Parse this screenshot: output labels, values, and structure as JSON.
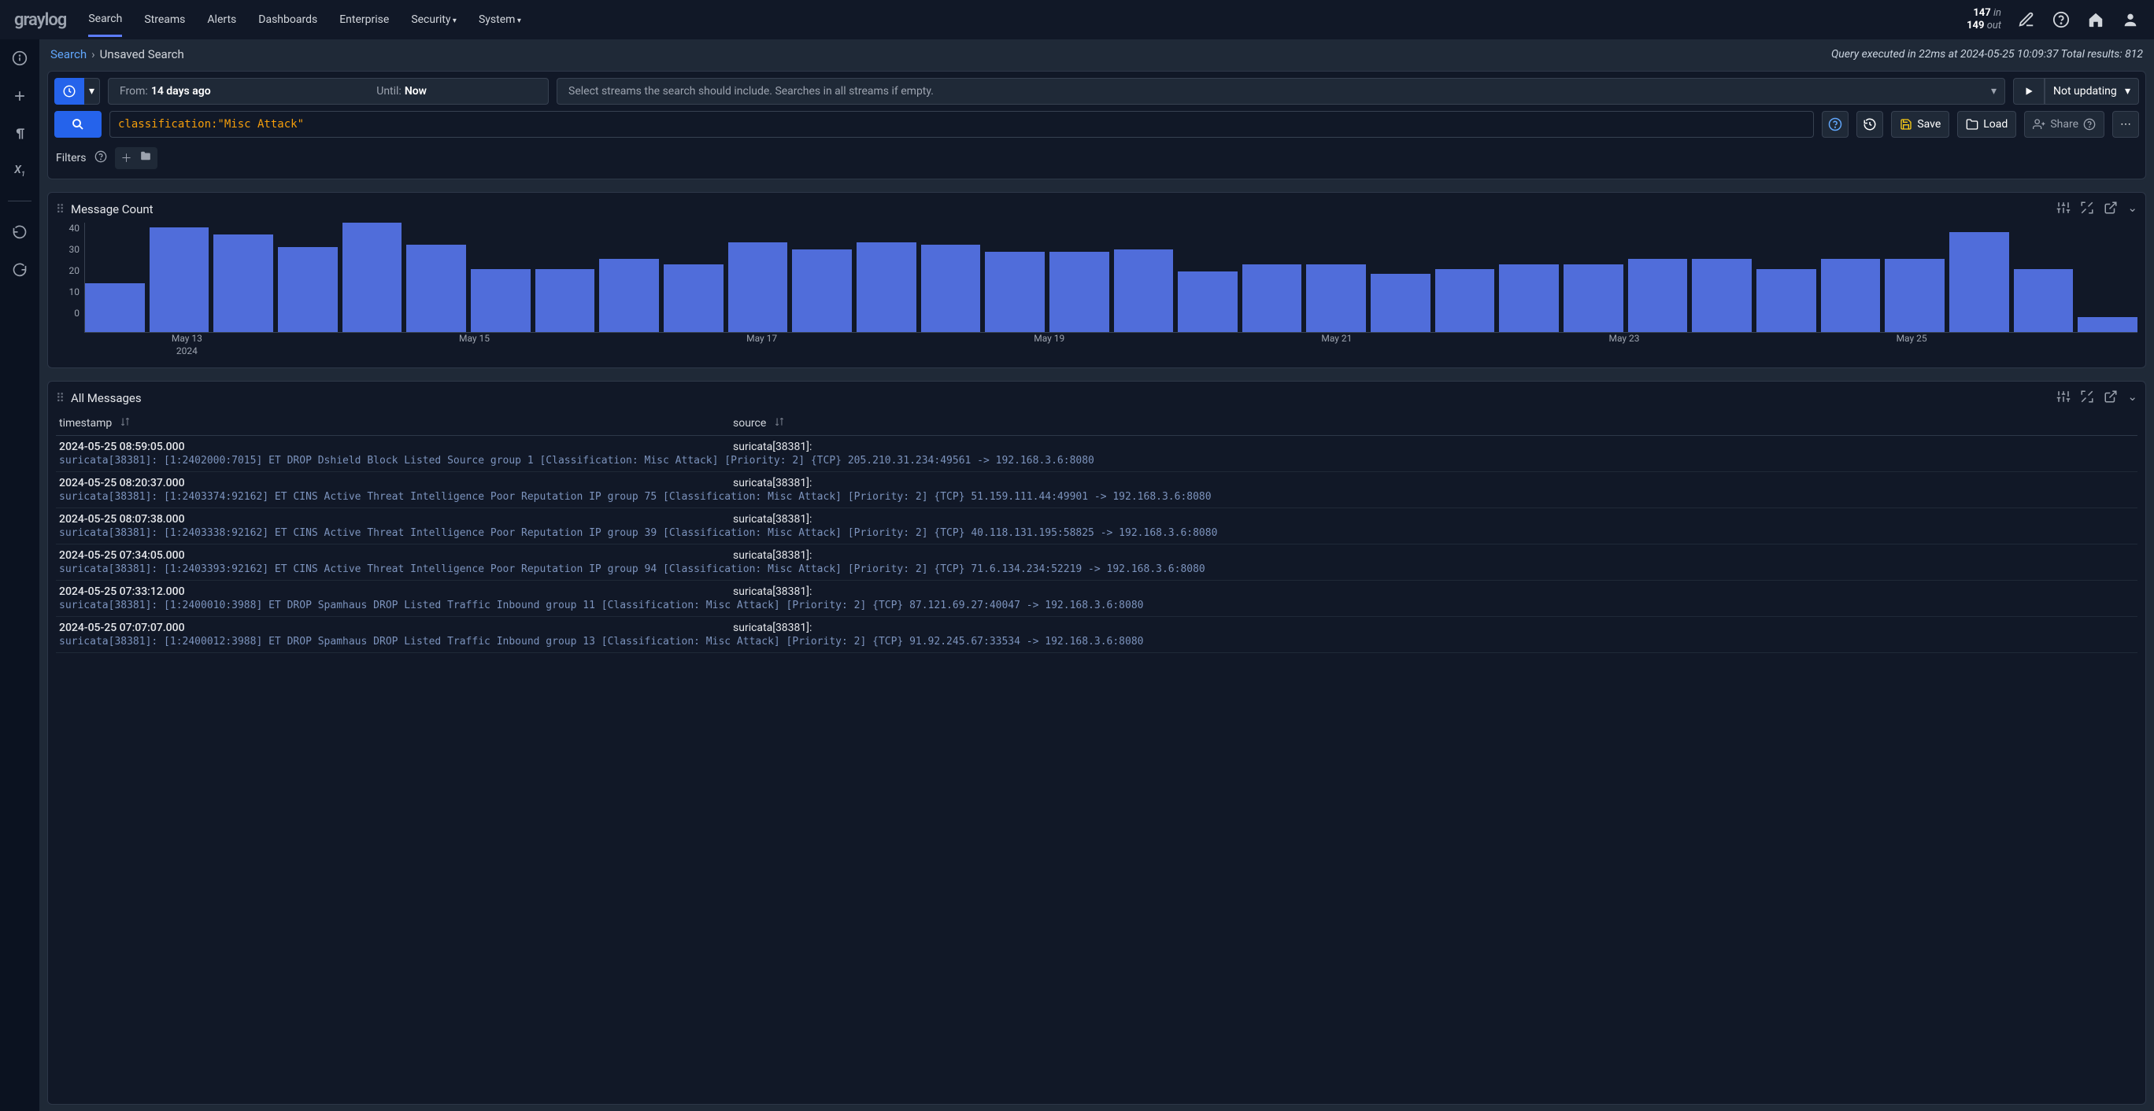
{
  "brand": "graylog",
  "nav": {
    "items": [
      "Search",
      "Streams",
      "Alerts",
      "Dashboards",
      "Enterprise",
      "Security",
      "System"
    ],
    "active": "Search",
    "dropdowns": [
      "Security",
      "System"
    ]
  },
  "io": {
    "in_n": "147",
    "in_l": "in",
    "out_n": "149",
    "out_l": "out"
  },
  "breadcrumb": {
    "root": "Search",
    "sep": "›",
    "current": "Unsaved Search"
  },
  "exec": "Query executed in 22ms at 2024-05-25 10:09:37 Total results: 812",
  "time": {
    "from_l": "From:",
    "from_v": "14 days ago",
    "until_l": "Until:",
    "until_v": "Now"
  },
  "streams_ph": "Select streams the search should include. Searches in all streams if empty.",
  "update": {
    "label": "Not updating"
  },
  "query": "classification:\"Misc Attack\"",
  "actions": {
    "save": "Save",
    "load": "Load",
    "share": "Share"
  },
  "filters_label": "Filters",
  "widget_mc": {
    "title": "Message Count"
  },
  "widget_am": {
    "title": "All Messages",
    "col_ts": "timestamp",
    "col_src": "source"
  },
  "chart_data": {
    "type": "bar",
    "ylabel": "",
    "ylim": [
      0,
      45
    ],
    "yticks": [
      0,
      10,
      20,
      30,
      40
    ],
    "xticks": [
      {
        "pos": 5,
        "label": "May 13",
        "sub": "2024"
      },
      {
        "pos": 19,
        "label": "May 15"
      },
      {
        "pos": 33,
        "label": "May 17"
      },
      {
        "pos": 47,
        "label": "May 19"
      },
      {
        "pos": 61,
        "label": "May 21"
      },
      {
        "pos": 75,
        "label": "May 23"
      },
      {
        "pos": 89,
        "label": "May 25"
      }
    ],
    "values": [
      20,
      43,
      40,
      35,
      45,
      36,
      26,
      26,
      30,
      28,
      37,
      34,
      37,
      36,
      33,
      33,
      34,
      25,
      28,
      28,
      24,
      26,
      28,
      28,
      30,
      30,
      26,
      30,
      30,
      41,
      26,
      6
    ]
  },
  "messages": [
    {
      "ts": "2024-05-25 08:59:05.000",
      "src": "suricata[38381]:",
      "full": "suricata[38381]: [1:2402000:7015] ET DROP Dshield Block Listed Source group 1 [Classification: Misc Attack] [Priority: 2] {TCP} 205.210.31.234:49561 -> 192.168.3.6:8080"
    },
    {
      "ts": "2024-05-25 08:20:37.000",
      "src": "suricata[38381]:",
      "full": "suricata[38381]: [1:2403374:92162] ET CINS Active Threat Intelligence Poor Reputation IP group 75 [Classification: Misc Attack] [Priority: 2] {TCP} 51.159.111.44:49901 -> 192.168.3.6:8080"
    },
    {
      "ts": "2024-05-25 08:07:38.000",
      "src": "suricata[38381]:",
      "full": "suricata[38381]: [1:2403338:92162] ET CINS Active Threat Intelligence Poor Reputation IP group 39 [Classification: Misc Attack] [Priority: 2] {TCP} 40.118.131.195:58825 -> 192.168.3.6:8080"
    },
    {
      "ts": "2024-05-25 07:34:05.000",
      "src": "suricata[38381]:",
      "full": "suricata[38381]: [1:2403393:92162] ET CINS Active Threat Intelligence Poor Reputation IP group 94 [Classification: Misc Attack] [Priority: 2] {TCP} 71.6.134.234:52219 -> 192.168.3.6:8080"
    },
    {
      "ts": "2024-05-25 07:33:12.000",
      "src": "suricata[38381]:",
      "full": "suricata[38381]: [1:2400010:3988] ET DROP Spamhaus DROP Listed Traffic Inbound group 11 [Classification: Misc Attack] [Priority: 2] {TCP} 87.121.69.27:40047 -> 192.168.3.6:8080"
    },
    {
      "ts": "2024-05-25 07:07:07.000",
      "src": "suricata[38381]:",
      "full": "suricata[38381]: [1:2400012:3988] ET DROP Spamhaus DROP Listed Traffic Inbound group 13 [Classification: Misc Attack] [Priority: 2] {TCP} 91.92.245.67:33534 -> 192.168.3.6:8080"
    }
  ]
}
